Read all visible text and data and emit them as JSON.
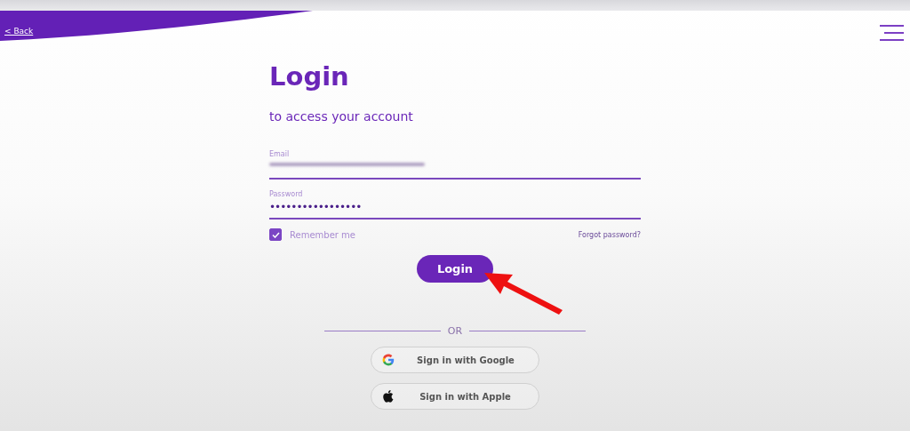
{
  "header": {
    "back_link": "< Back"
  },
  "login": {
    "title": "Login",
    "subtitle": "to access your account",
    "email": {
      "label": "Email"
    },
    "password": {
      "label": "Password",
      "value": "•••••••••••••••••"
    },
    "remember_me": {
      "label": "Remember me",
      "checked": true
    },
    "forgot_link": "Forgot password?",
    "submit": "Login",
    "divider": "OR",
    "social_buttons": [
      {
        "kind": "google",
        "label": "Sign in with Google"
      },
      {
        "kind": "apple",
        "label": "Sign in with Apple"
      }
    ]
  }
}
